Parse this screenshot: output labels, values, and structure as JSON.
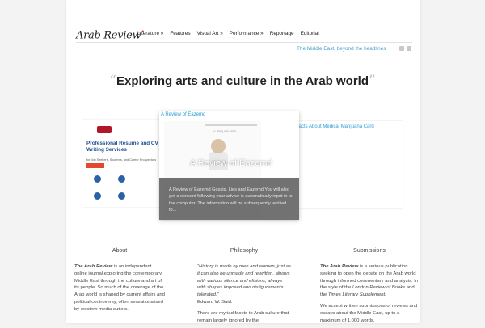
{
  "header": {
    "logo": "Arab Review",
    "nav": [
      "Literature »",
      "Features",
      "Visual Art »",
      "Performance »",
      "Reportage",
      "Editorial"
    ],
    "tagline": "The Middle East, beyond the headlines",
    "social_icons": [
      "twitter-icon",
      "feed-icon"
    ]
  },
  "hero": {
    "open_quote": "“",
    "title": "Exploring arts and culture in the Arab world",
    "close_quote": "”"
  },
  "slider": {
    "left": {
      "ad_title": "Professional Resume and CV Writing Services",
      "ad_subtitle": "for Job Seekers, Students, and Career Prospectors"
    },
    "center": {
      "link": "A Review of Eazemd",
      "title": "A Review of Eazemd",
      "phone": "+1 (800) 000 0000",
      "excerpt": "A Review of Eazemd Gossip, Lies and Eazemd You will also get a consent following your advice is automatically input in to the computer. The information will be subsequently verified to..."
    },
    "right": {
      "link": "The Dirty Facts About Medical Marijuana Card"
    }
  },
  "columns": {
    "about": {
      "heading": "About",
      "lead": "The Arab Review",
      "text": " is an independent online journal exploring the contemporary Middle East through the culture and art of its people. So much of the coverage of the Arab world is shaped by current affairs and political controversy, often sensationalised by western media outlets."
    },
    "philosophy": {
      "heading": "Philosophy",
      "quote": "“History is made by men and women, just as it can also be unmade and rewritten, always with various silence and elisions, always with shapes imposed and disfigurements tolerated.”",
      "attribution": "Edward W. Said.",
      "text": "There are myriad facets to Arab culture that remain largely ignored by the"
    },
    "submissions": {
      "heading": "Submissions",
      "lead": "The Arab Review",
      "text1": " is a serious publication seeking to open the debate on the Arab world through informed commentary and analysis. In the style of the ",
      "pub1": "London Review of Books",
      "text2": " and the ",
      "pub2": "Times Literary Supplement.",
      "text3": "We accept written submissions of reviews and essays about the Middle East, up to a maximum of 1,000 words."
    }
  }
}
